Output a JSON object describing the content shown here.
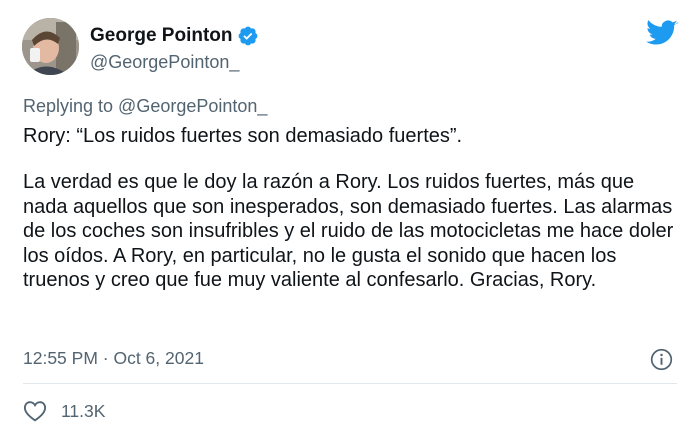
{
  "author": {
    "display_name": "George Pointon",
    "handle": "@GeorgePointon_",
    "verified_icon": "verified-badge-icon"
  },
  "reply": {
    "text": "Replying to @GeorgePointon_"
  },
  "tweet": {
    "paragraph_1": "Rory: “Los ruidos fuertes son demasiado fuertes”.",
    "paragraph_2": "La verdad es que le doy la razón a Rory. Los ruidos fuertes, más que nada aquellos que son inesperados, son demasiado fuertes. Las alarmas de los coches son insufribles y el ruido de las motocicletas me hace doler los oídos. A Rory, en particular, no le gusta el sonido que hacen los truenos y creo que fue muy valiente al confesarlo. Gracias, Rory.",
    "timestamp": "12:55 PM · Oct 6, 2021"
  },
  "engagement": {
    "likes": "11.3K"
  },
  "colors": {
    "brand": "#1d9bf0",
    "secondary_text": "#536471",
    "primary_text": "#0f1419"
  }
}
